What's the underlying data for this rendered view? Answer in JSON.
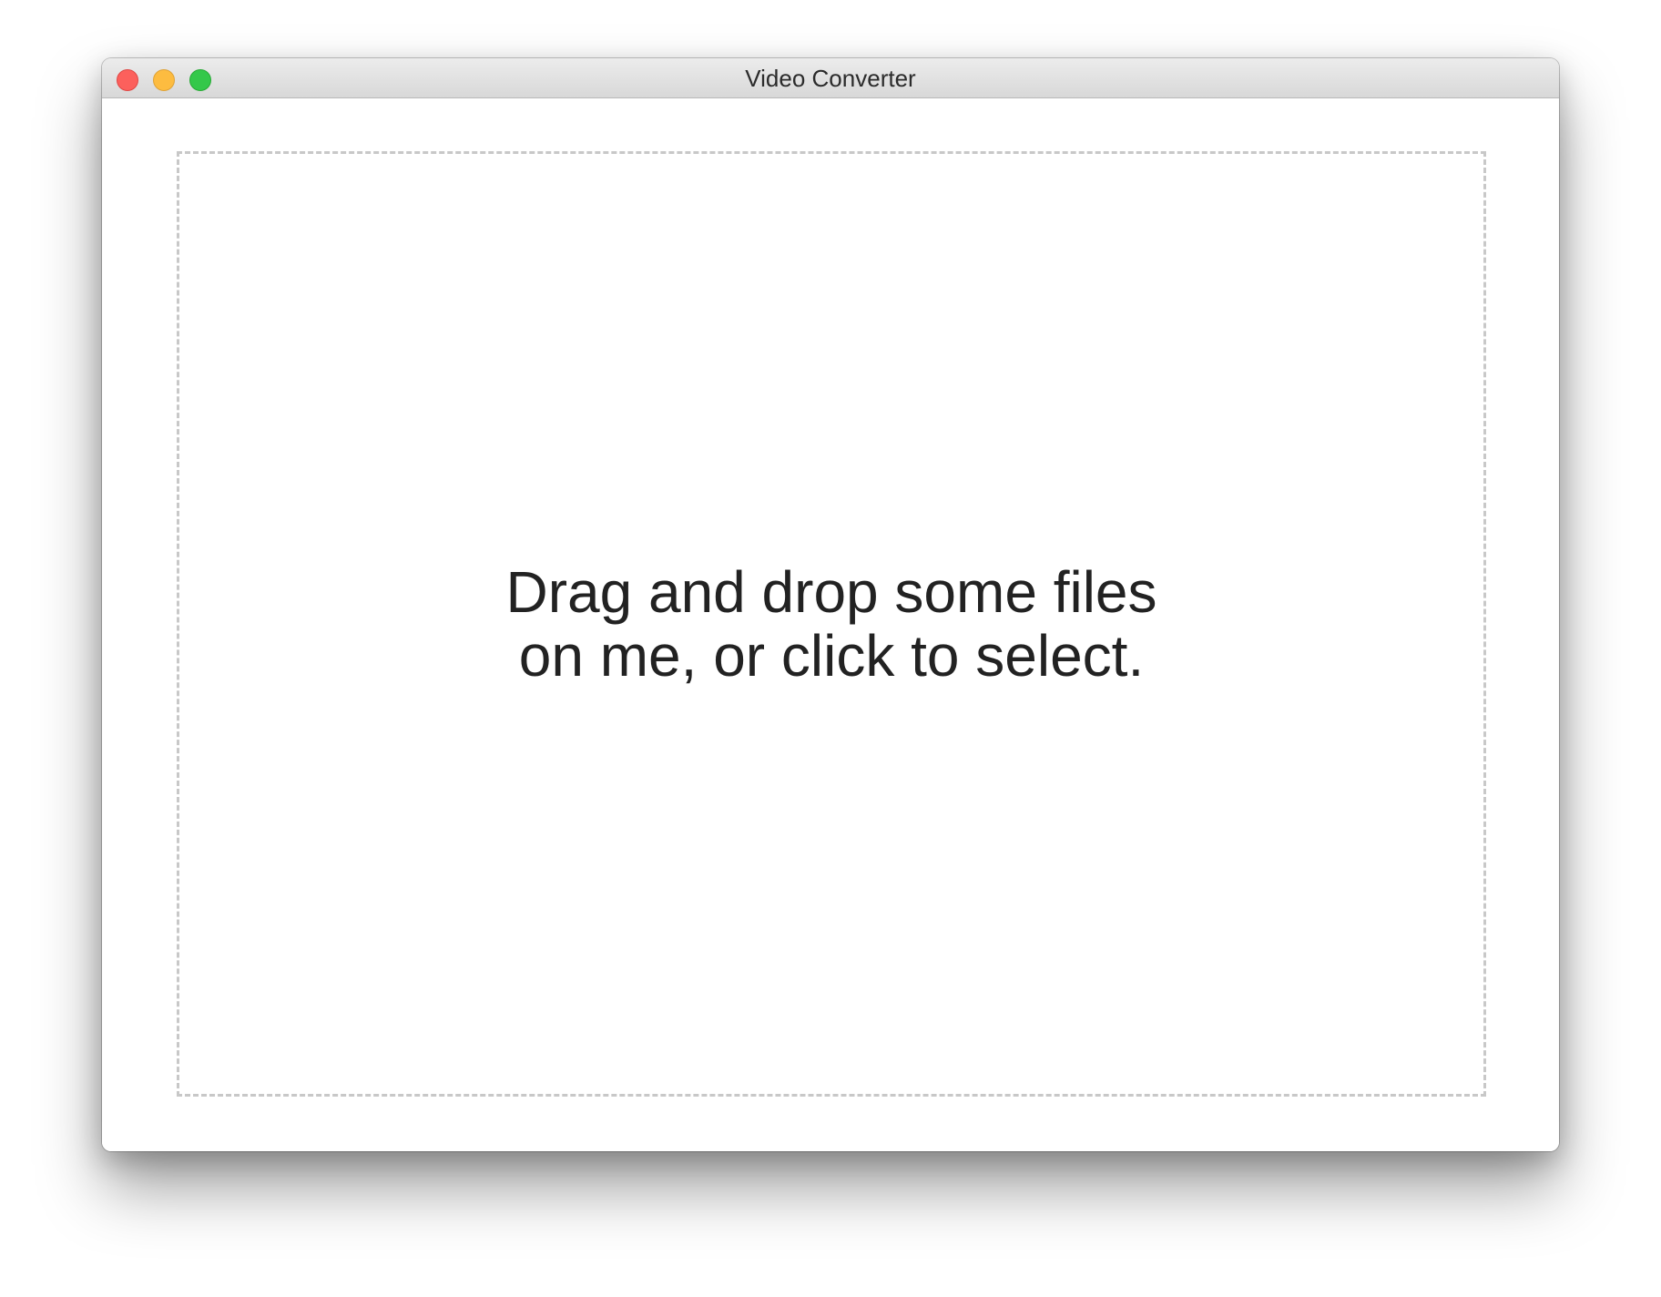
{
  "window": {
    "title": "Video Converter",
    "controls": {
      "close": {
        "color": "#fc605c",
        "icon": "close-icon"
      },
      "minimize": {
        "color": "#fdbc40",
        "icon": "minimize-icon"
      },
      "zoom": {
        "color": "#34c84a",
        "icon": "zoom-icon"
      }
    }
  },
  "dropzone": {
    "text": "Drag and drop some files\non me, or click to select.",
    "border_color": "#c8c8c8"
  }
}
